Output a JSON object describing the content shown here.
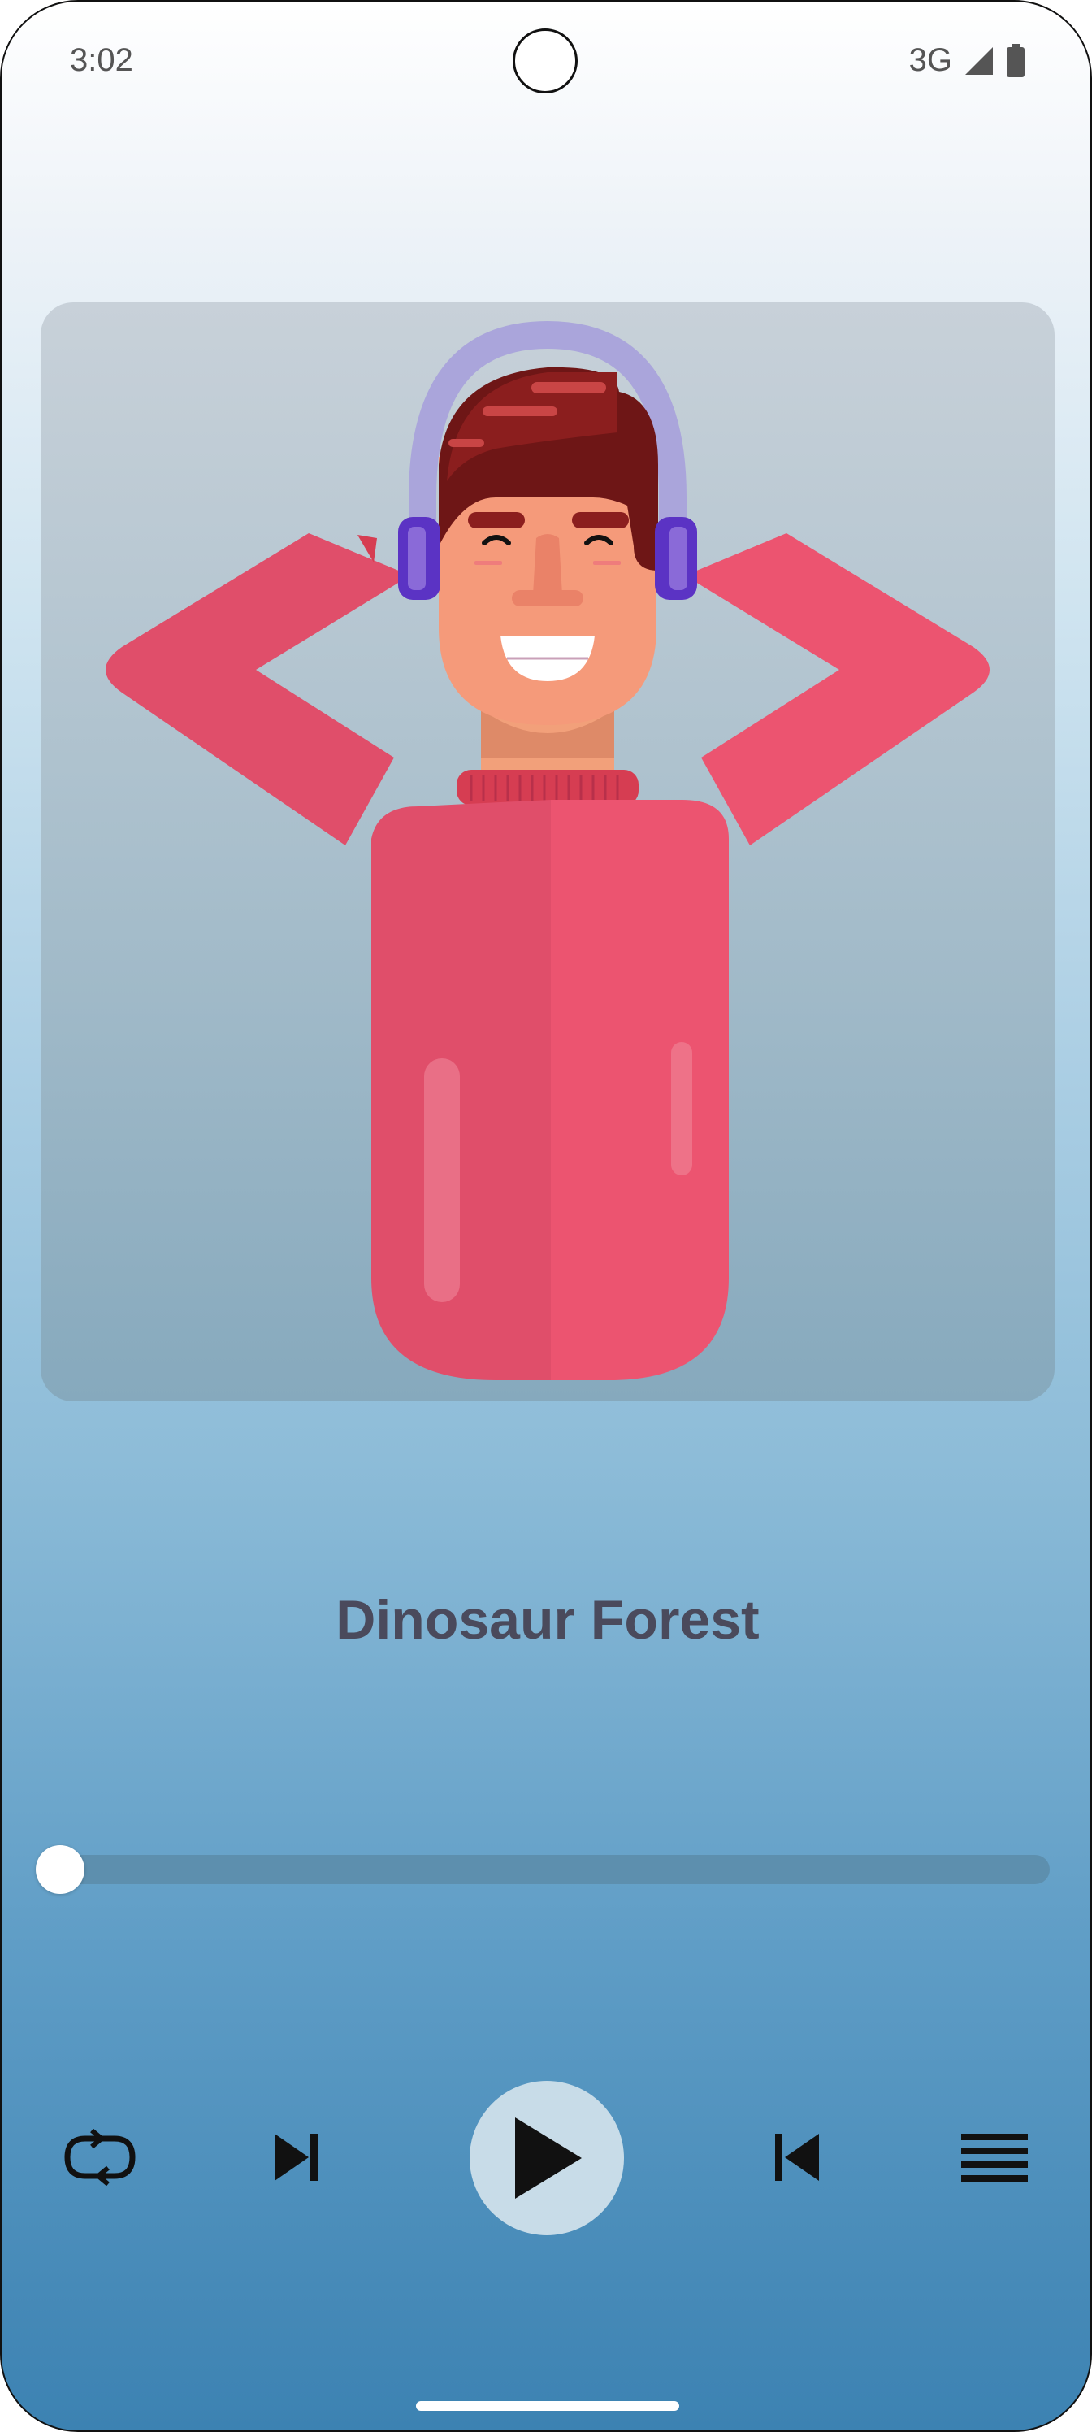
{
  "status_bar": {
    "time": "3:02",
    "network": "3G",
    "icons": [
      "signal-icon",
      "battery-icon"
    ]
  },
  "album_art": {
    "description_icon": "man-with-headphones-illustration"
  },
  "track": {
    "title": "Dinosaur Forest"
  },
  "seek": {
    "progress": 0
  },
  "controls": {
    "buttons": [
      "repeat-icon",
      "skip-next-icon",
      "play-icon",
      "skip-previous-icon",
      "playlist-icon"
    ]
  },
  "colors": {
    "title": "#4a4a5c",
    "seek_track": "#5d8fae",
    "play_button_bg": "#c8dce8"
  }
}
